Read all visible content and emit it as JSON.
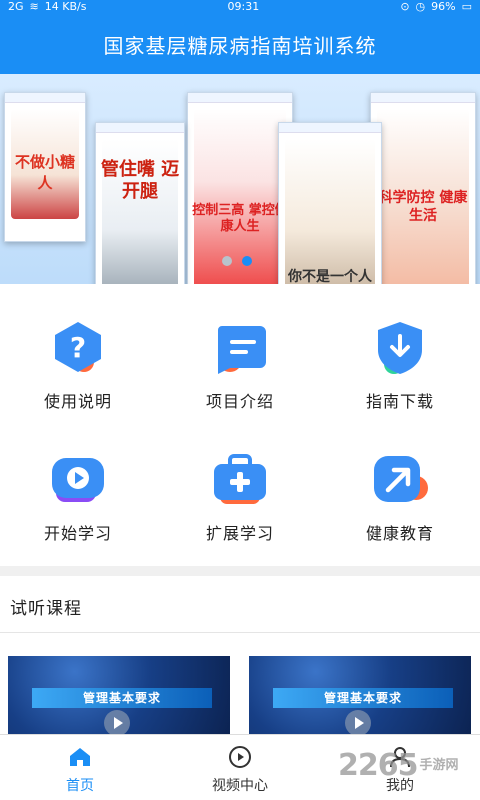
{
  "status": {
    "network": "2G",
    "speed": "14 KB/s",
    "time": "09:31",
    "battery": "96%"
  },
  "header": {
    "title": "国家基层糖尿病指南培训系统"
  },
  "banner": {
    "posters": [
      {
        "caption": "不做小糖人"
      },
      {
        "caption": "管住嘴 迈开腿"
      },
      {
        "caption": "控制三高 掌控健康人生"
      },
      {
        "caption": "你不是一个人 在战斗"
      },
      {
        "caption": "科学防控 健康生活"
      }
    ],
    "dots": {
      "count": 2,
      "active_index": 1
    }
  },
  "menu": {
    "items": [
      {
        "label": "使用说明",
        "icon": "question-icon",
        "color": "#3a8ff5"
      },
      {
        "label": "项目介绍",
        "icon": "chat-lines-icon",
        "color": "#3a8ff5"
      },
      {
        "label": "指南下载",
        "icon": "download-shield-icon",
        "color": "#3a8ff5"
      },
      {
        "label": "开始学习",
        "icon": "play-screen-icon",
        "color": "#3a8ff5"
      },
      {
        "label": "扩展学习",
        "icon": "medical-kit-icon",
        "color": "#3a8ff5"
      },
      {
        "label": "健康教育",
        "icon": "arrow-up-right-icon",
        "color": "#3a8ff5"
      }
    ]
  },
  "trial": {
    "title": "试听课程",
    "courses": [
      {
        "title": "管理基本要求"
      },
      {
        "title": "管理基本要求"
      }
    ]
  },
  "tabs": [
    {
      "label": "首页",
      "icon": "home-icon",
      "active": true
    },
    {
      "label": "视频中心",
      "icon": "play-circle-icon",
      "active": false
    },
    {
      "label": "我的",
      "icon": "user-icon",
      "active": false
    }
  ],
  "watermark": {
    "number": "2265",
    "text": "手游网"
  },
  "colors": {
    "primary": "#1a8ef5",
    "accent_orange": "#ff6a3d",
    "accent_green": "#2fd39a",
    "accent_purple": "#8a4cf5"
  }
}
